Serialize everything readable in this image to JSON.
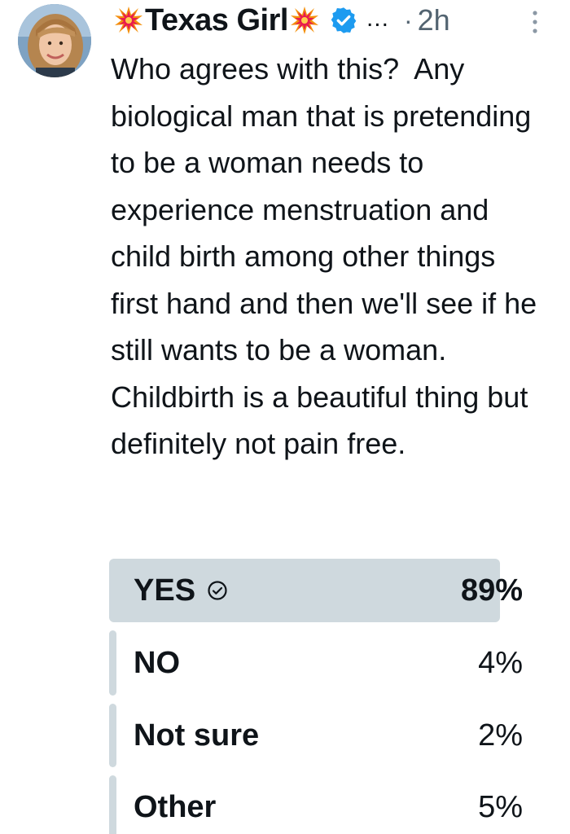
{
  "author": {
    "display_name": "Texas Girl",
    "name_decoration_icon": "collision-icon",
    "verified_icon": "verified-badge-icon",
    "verified_color": "#1d9bf0",
    "more_text": "...",
    "separator": "·",
    "timestamp": "2h",
    "avatar_icon": "avatar"
  },
  "tweet": {
    "text": "Who agrees with this?  Any biological man that is pretending to be a woman needs to experience menstruation and child birth among other things first hand and then we'll see if he still wants to be a woman.  Childbirth is a beautiful thing but definitely not pain free."
  },
  "poll": {
    "fill_color": "#cfd9de",
    "options": [
      {
        "label": "YES",
        "percent": "89%",
        "value": 89,
        "winner": true
      },
      {
        "label": "NO",
        "percent": "4%",
        "value": 4,
        "winner": false
      },
      {
        "label": "Not sure",
        "percent": "2%",
        "value": 2,
        "winner": false
      },
      {
        "label": "Other",
        "percent": "5%",
        "value": 5,
        "winner": false
      }
    ]
  }
}
